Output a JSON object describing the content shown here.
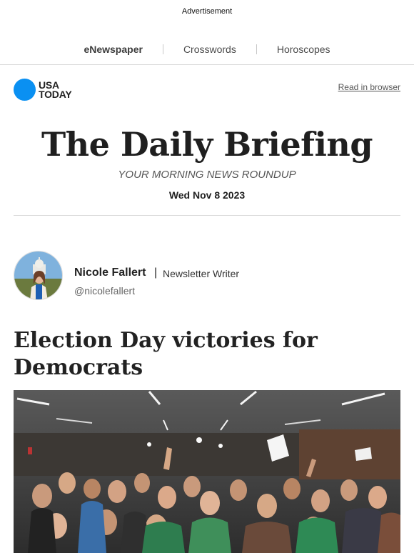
{
  "advertisement": "Advertisement",
  "topnav": {
    "items": [
      "eNewspaper",
      "Crosswords",
      "Horoscopes"
    ]
  },
  "logo": {
    "line1": "USA",
    "line2": "TODAY",
    "brand_color": "#0a90f2"
  },
  "read_in_browser": "Read in browser",
  "masthead": {
    "title": "The Daily Briefing",
    "tagline": "YOUR MORNING NEWS ROUNDUP",
    "date": "Wed Nov 8 2023"
  },
  "author": {
    "name": "Nicole Fallert",
    "separator": "|",
    "role": "Newsletter Writer",
    "handle": "@nicolefallert"
  },
  "article": {
    "headline": "Election Day victories for Democrats"
  }
}
